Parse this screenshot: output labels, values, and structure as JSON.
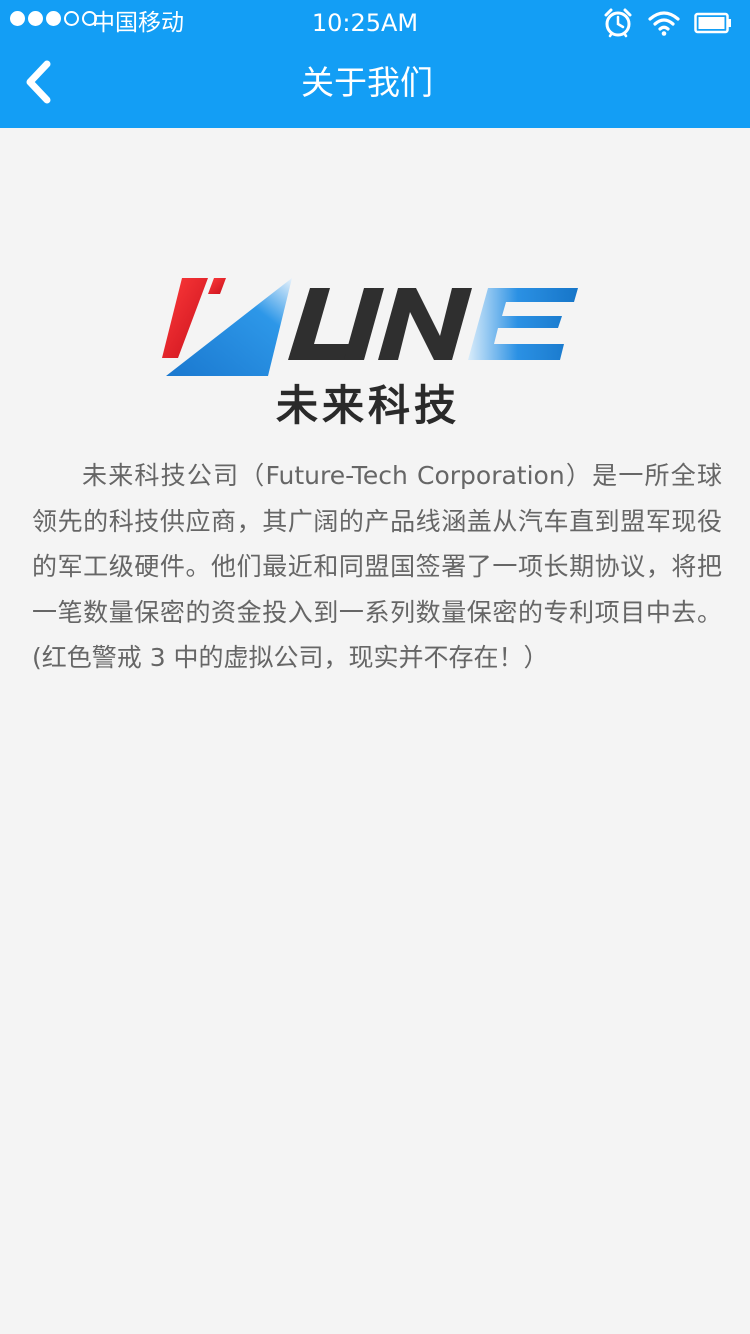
{
  "status_bar": {
    "carrier": "中国移动",
    "time": "10:25AM",
    "signal_strength": "3 of 5",
    "icons": [
      "alarm-icon",
      "wifi-icon",
      "battery-icon"
    ]
  },
  "navbar": {
    "title": "关于我们",
    "back_icon": "chevron-left-icon"
  },
  "about": {
    "logo_text": "VLINE",
    "logo_subtitle": "未来科技",
    "description": "未来科技公司（Future-Tech Corporation）是一所全球领先的科技供应商，其广阔的产品线涵盖从汽车直到盟军现役的军工级硬件。他们最近和同盟国签署了一项长期协议，将把一笔数量保密的资金投入到一系列数量保密的专利项目中去。(红色警戒 3 中的虚拟公司，现实并不存在！）"
  },
  "colors": {
    "nav_background": "#139ef5",
    "page_background": "#f4f4f4",
    "text": "#666666",
    "logo_red": "#e01e26",
    "logo_blue": "#1c7fd4",
    "logo_dark": "#2f2f2f"
  }
}
